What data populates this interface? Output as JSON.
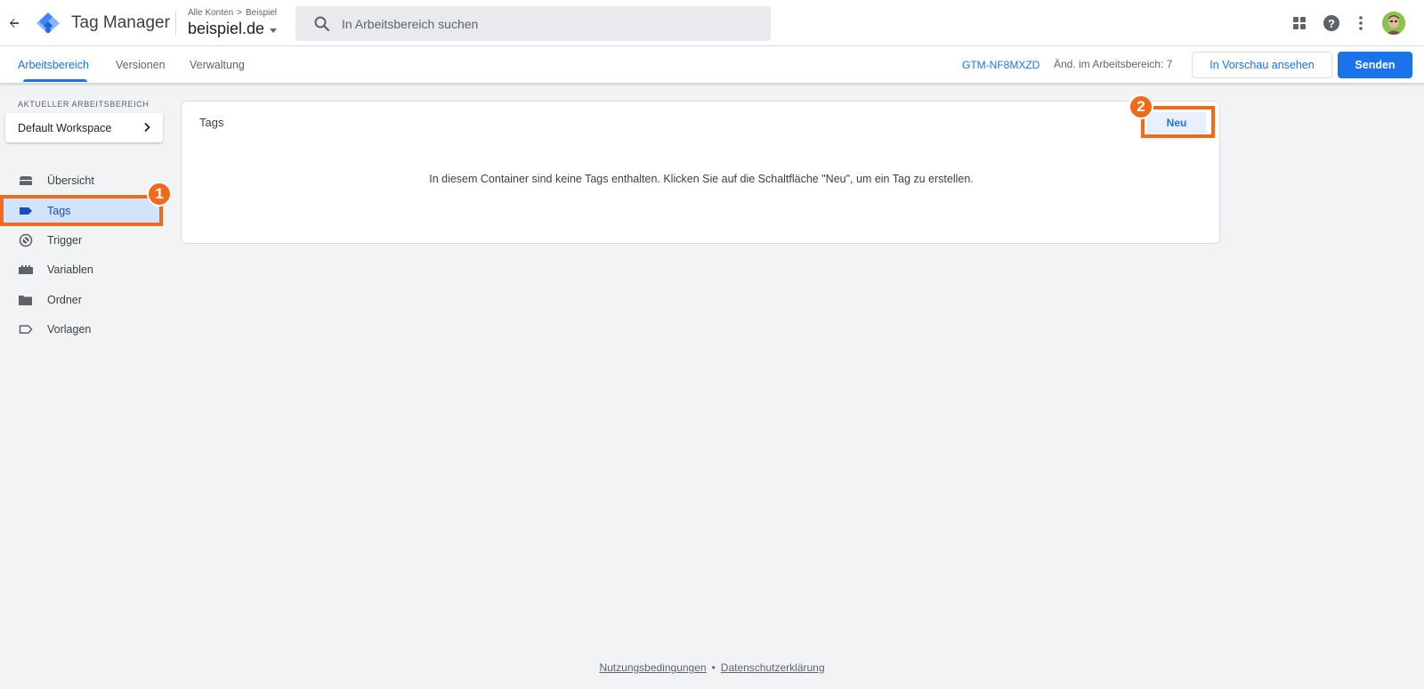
{
  "header": {
    "app_title": "Tag Manager",
    "breadcrumb": {
      "account": "Alle Konten",
      "separator": ">",
      "container": "Beispiel"
    },
    "container_name": "beispiel.de",
    "search_placeholder": "In Arbeitsbereich suchen"
  },
  "subnav": {
    "tabs": [
      {
        "label": "Arbeitsbereich",
        "active": true
      },
      {
        "label": "Versionen",
        "active": false
      },
      {
        "label": "Verwaltung",
        "active": false
      }
    ],
    "container_id": "GTM-NF8MXZD",
    "changes_label": "Änd. im Arbeitsbereich: 7",
    "preview_label": "In Vorschau ansehen",
    "submit_label": "Senden"
  },
  "sidebar": {
    "workspace_heading": "AKTUELLER ARBEITSBEREICH",
    "workspace_name": "Default Workspace",
    "items": [
      {
        "label": "Übersicht",
        "icon": "overview-icon",
        "active": false
      },
      {
        "label": "Tags",
        "icon": "tag-icon",
        "active": true
      },
      {
        "label": "Trigger",
        "icon": "trigger-icon",
        "active": false
      },
      {
        "label": "Variablen",
        "icon": "variables-icon",
        "active": false
      },
      {
        "label": "Ordner",
        "icon": "folder-icon",
        "active": false
      },
      {
        "label": "Vorlagen",
        "icon": "template-icon",
        "active": false
      }
    ]
  },
  "main": {
    "card_title": "Tags",
    "new_button": "Neu",
    "empty_message": "In diesem Container sind keine Tags enthalten. Klicken Sie auf die Schaltfläche \"Neu\", um ein Tag zu erstellen."
  },
  "annotations": [
    {
      "number": "1",
      "target": "sidebar-item-tags"
    },
    {
      "number": "2",
      "target": "new-tag-button"
    }
  ],
  "footer": {
    "terms": "Nutzungsbedingungen",
    "separator": "•",
    "privacy": "Datenschutzerklärung"
  },
  "colors": {
    "accent": "#1a73e8",
    "highlight": "#f06a1a",
    "active_nav_bg": "#d2e3fc"
  }
}
